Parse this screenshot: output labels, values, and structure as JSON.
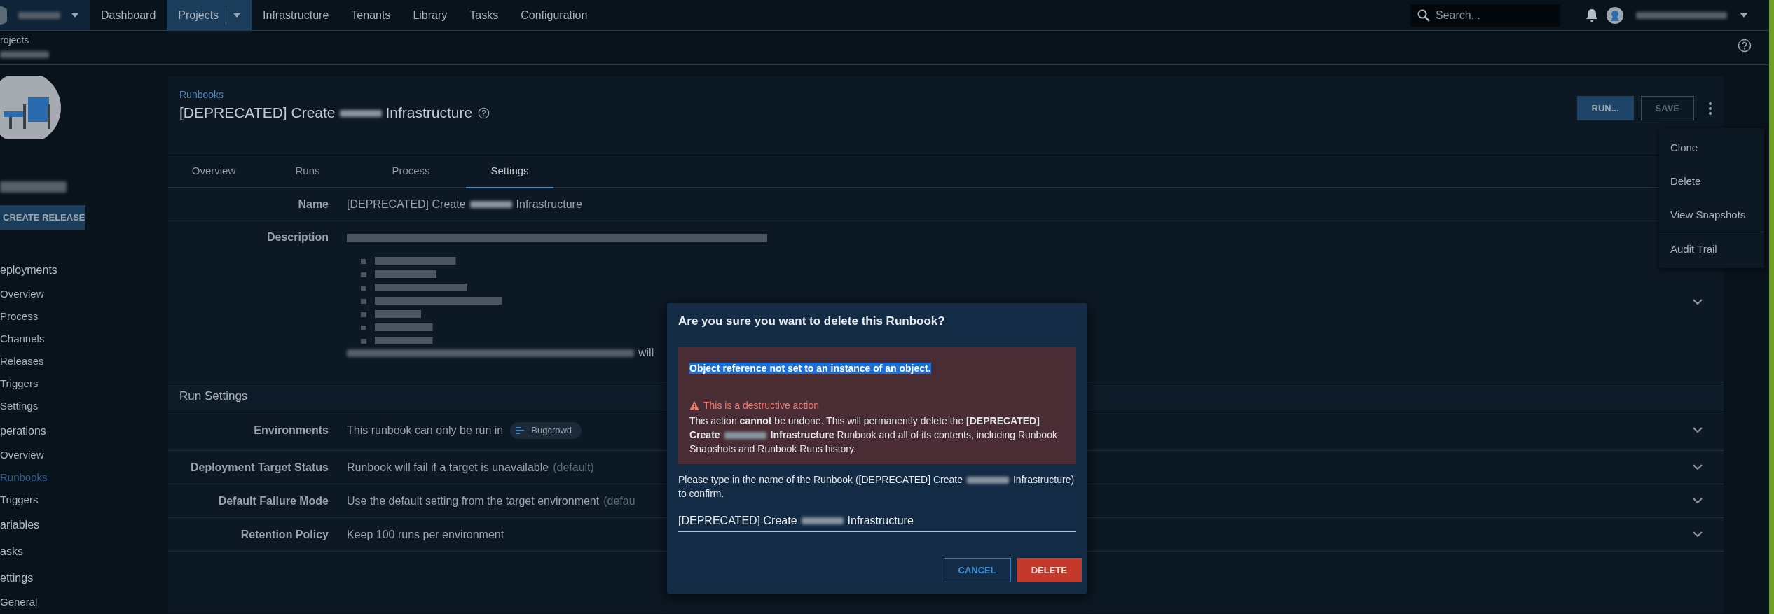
{
  "nav": {
    "items": [
      {
        "label": "Dashboard",
        "selected": false,
        "dropdown": false
      },
      {
        "label": "Projects",
        "selected": true,
        "dropdown": true
      },
      {
        "label": "Infrastructure",
        "selected": false,
        "dropdown": false
      },
      {
        "label": "Tenants",
        "selected": false,
        "dropdown": false
      },
      {
        "label": "Library",
        "selected": false,
        "dropdown": false
      },
      {
        "label": "Tasks",
        "selected": false,
        "dropdown": false
      },
      {
        "label": "Configuration",
        "selected": false,
        "dropdown": false
      }
    ],
    "search": {
      "placeholder": "Search..."
    }
  },
  "breadcrumb": "rojects",
  "sidebar": {
    "button": "CREATE RELEASE",
    "items": [
      {
        "kind": "heading",
        "label": "eployments"
      },
      {
        "kind": "link",
        "label": "Overview",
        "selected": false
      },
      {
        "kind": "link",
        "label": "Process",
        "selected": false
      },
      {
        "kind": "link",
        "label": "Channels",
        "selected": false
      },
      {
        "kind": "link",
        "label": "Releases",
        "selected": false
      },
      {
        "kind": "link",
        "label": "Triggers",
        "selected": false
      },
      {
        "kind": "link",
        "label": "Settings",
        "selected": false
      },
      {
        "kind": "heading",
        "label": "perations"
      },
      {
        "kind": "link",
        "label": "Overview",
        "selected": false
      },
      {
        "kind": "link",
        "label": "Runbooks",
        "selected": true
      },
      {
        "kind": "link",
        "label": "Triggers",
        "selected": false
      },
      {
        "kind": "heading",
        "label": "ariables"
      },
      {
        "kind": "heading",
        "label": "asks"
      },
      {
        "kind": "heading",
        "label": "ettings"
      },
      {
        "kind": "link",
        "label": "General",
        "selected": false
      }
    ]
  },
  "header": {
    "breadcrumb": "Runbooks",
    "title_parts": [
      "[DEPRECATED] Create",
      "Infrastructure"
    ],
    "buttons": [
      {
        "label": "RUN...",
        "kind": "primary"
      },
      {
        "label": "SAVE",
        "kind": "outline"
      }
    ]
  },
  "menu": [
    {
      "label": "Clone",
      "divider_before": false
    },
    {
      "label": "Delete",
      "divider_before": false
    },
    {
      "label": "View Snapshots",
      "divider_before": false
    },
    {
      "label": "Audit Trail",
      "divider_before": true
    }
  ],
  "tabs": [
    {
      "label": "Overview",
      "selected": false
    },
    {
      "label": "Runs",
      "selected": false
    },
    {
      "label": "Process",
      "selected": false
    },
    {
      "label": "Settings",
      "selected": true
    }
  ],
  "name_row": {
    "label": "Name",
    "value_parts": [
      "[DEPRECATED] Create",
      "Infrastructure"
    ]
  },
  "description_row": {
    "label": "Description",
    "tail": "will"
  },
  "run_settings": {
    "title": "Run Settings",
    "rows": [
      {
        "kind": "chip",
        "label": "Environments",
        "value": "This runbook can only be run in",
        "chip": "Bugcrowd"
      },
      {
        "kind": "text",
        "label": "Deployment Target Status",
        "value": "Runbook will fail if a target is unavailable",
        "note": "(default)"
      },
      {
        "kind": "text",
        "label": "Default Failure Mode",
        "value": "Use the default setting from the target environment",
        "note": "(defau"
      },
      {
        "kind": "text",
        "label": "Retention Policy",
        "value": "Keep 100 runs per environment"
      }
    ]
  },
  "dialog": {
    "title": "Are you sure you want to delete this Runbook?",
    "error": {
      "text": "Object reference not set to an instance of an object.",
      "highlighted": true
    },
    "warning_title": "This is a destructive action",
    "warning_parts": [
      "This action **cannot** be undone. This will permanently delete the **[DEPRECATED] Create**",
      "**Infrastructure** Runbook and all of its contents, including Runbook Snapshots and Runbook Runs history."
    ],
    "prompt_parts": [
      "Please type in the name of the Runbook ([DEPRECATED] Create",
      "Infrastructure) to confirm."
    ],
    "input_parts": [
      "[DEPRECATED] Create",
      "Infrastructure"
    ],
    "buttons": [
      {
        "label": "CANCEL",
        "kind": "outline"
      },
      {
        "label": "DELETE",
        "kind": "danger"
      }
    ]
  }
}
